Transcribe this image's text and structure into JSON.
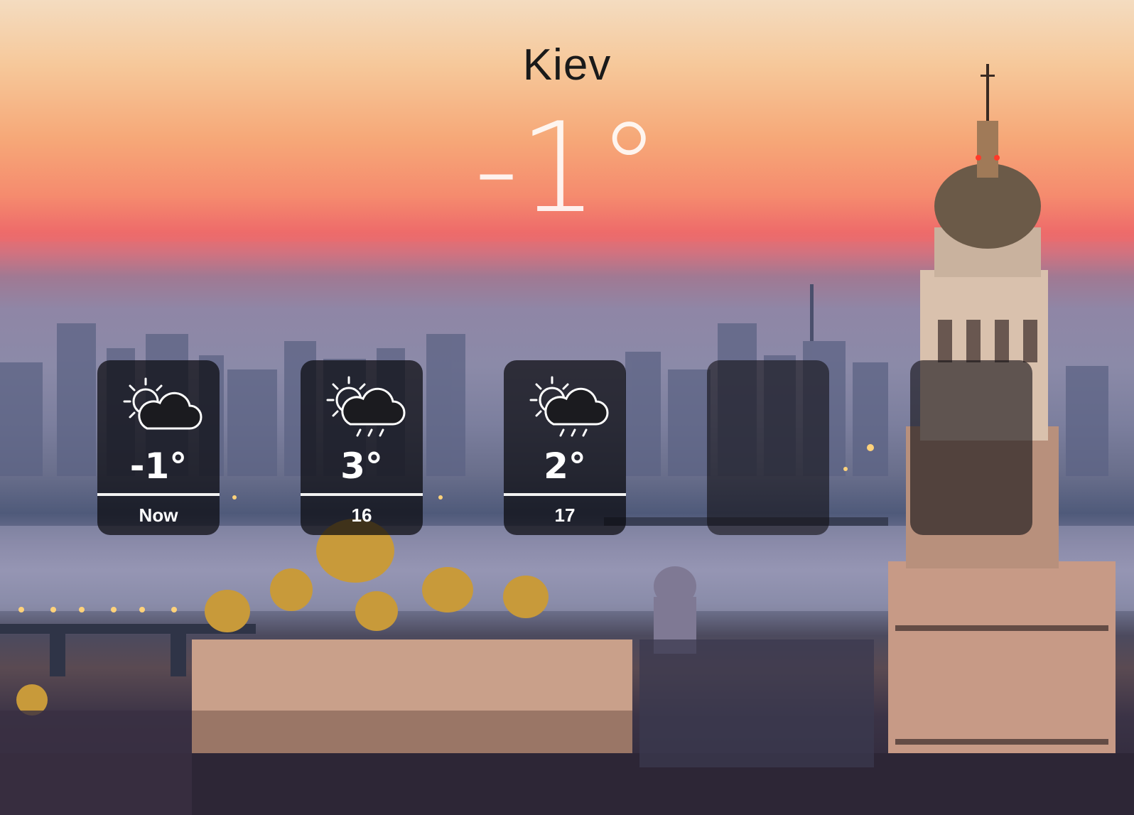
{
  "location": {
    "city": "Kiev",
    "current_temperature": "-1°"
  },
  "forecast": [
    {
      "label": "Now",
      "temperature": "-1°",
      "icon": "sun-behind-cloud-icon"
    },
    {
      "label": "16",
      "temperature": "3°",
      "icon": "sun-behind-rain-cloud-icon"
    },
    {
      "label": "17",
      "temperature": "2°",
      "icon": "sun-behind-rain-cloud-icon"
    },
    {
      "label": "",
      "temperature": "",
      "icon": ""
    },
    {
      "label": "",
      "temperature": "",
      "icon": ""
    }
  ],
  "background": {
    "sky_top": "#f4dcc0",
    "sky_mid": "#f58b6e",
    "horizon": "#ee6b6a",
    "city": "#6a6f8c"
  }
}
